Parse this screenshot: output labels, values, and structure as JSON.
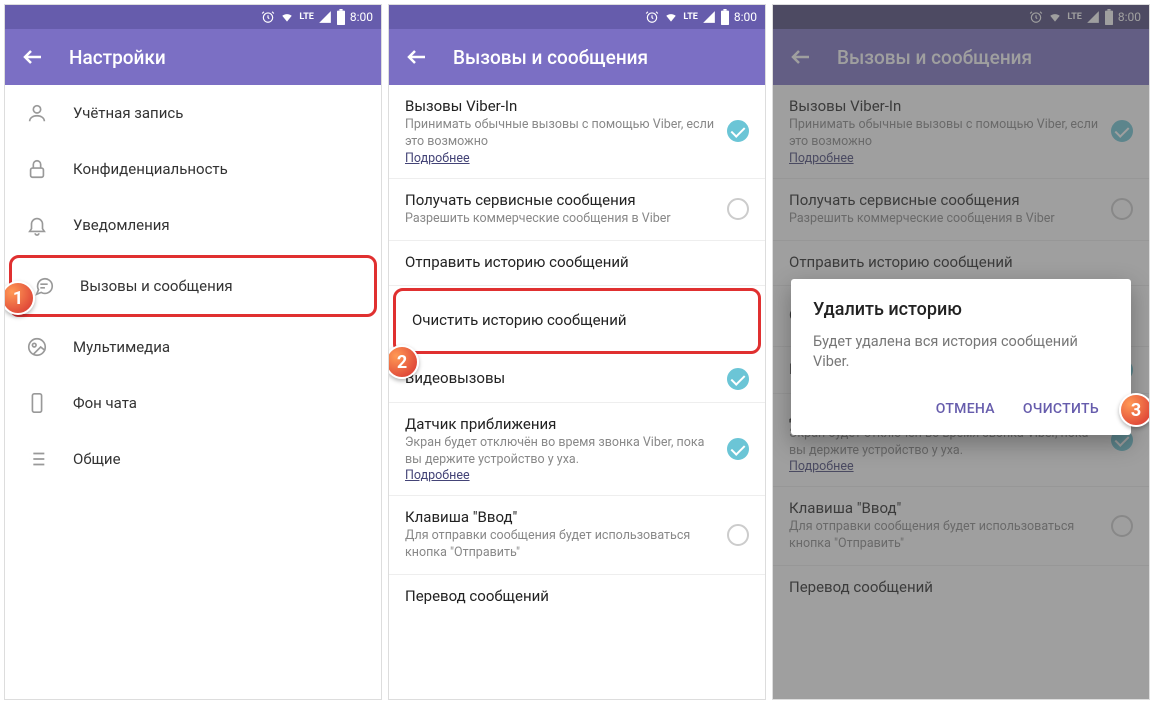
{
  "statusbar": {
    "time": "8:00",
    "net": "LTE"
  },
  "screen1": {
    "title": "Настройки",
    "items": [
      {
        "label": "Учётная запись"
      },
      {
        "label": "Конфиденциальность"
      },
      {
        "label": "Уведомления"
      },
      {
        "label": "Вызовы и сообщения"
      },
      {
        "label": "Мультимедиа"
      },
      {
        "label": "Фон чата"
      },
      {
        "label": "Общие"
      }
    ]
  },
  "screen2": {
    "title": "Вызовы и сообщения",
    "viberin": {
      "title": "Вызовы Viber-In",
      "desc": "Принимать обычные вызовы с помощью Viber, если это возможно",
      "link": "Подробнее"
    },
    "service": {
      "title": "Получать сервисные сообщения",
      "desc": "Разрешить коммерческие сообщения в Viber"
    },
    "sendhist": {
      "title": "Отправить историю сообщений"
    },
    "clearhist": {
      "title": "Очистить историю сообщений"
    },
    "video": {
      "title": "Видеовызовы"
    },
    "proximity": {
      "title": "Датчик приближения",
      "desc": "Экран будет отключён во время звонка Viber, пока вы держите устройство у уха.",
      "link": "Подробнее"
    },
    "enter": {
      "title": "Клавиша \"Ввод\"",
      "desc": "Для отправки сообщения будет использоваться кнопка \"Отправить\""
    },
    "translate": {
      "title": "Перевод сообщений"
    }
  },
  "dialog": {
    "title": "Удалить историю",
    "msg": "Будет удалена вся история сообщений Viber.",
    "cancel": "ОТМЕНА",
    "confirm": "ОЧИСТИТЬ"
  },
  "steps": {
    "s1": "1",
    "s2": "2",
    "s3": "3"
  }
}
